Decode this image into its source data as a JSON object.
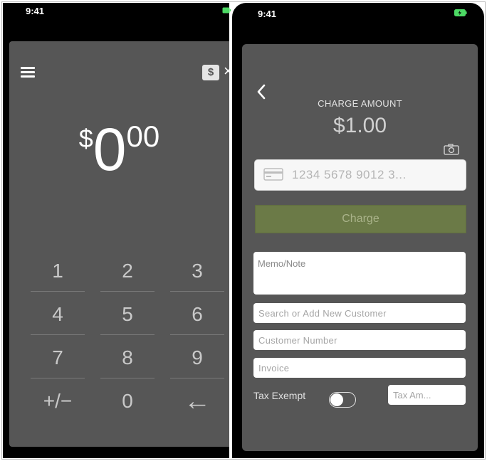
{
  "left_screen": {
    "status": {
      "time": "9:41"
    },
    "currency_icon": "$",
    "amount": {
      "currency": "$",
      "whole": "0",
      "cents": "00"
    },
    "keypad": {
      "keys": [
        {
          "label": "1"
        },
        {
          "label": "2"
        },
        {
          "label": "3"
        },
        {
          "label": "4"
        },
        {
          "label": "5"
        },
        {
          "label": "6"
        },
        {
          "label": "7"
        },
        {
          "label": "8"
        },
        {
          "label": "9"
        },
        {
          "label": "+/−"
        },
        {
          "label": "0"
        },
        {
          "label": "←"
        }
      ]
    }
  },
  "right_screen": {
    "status": {
      "time": "9:41"
    },
    "charge_label": "CHARGE AMOUNT",
    "charge_amount": "$1.00",
    "card_placeholder": "1234 5678 9012 3...",
    "charge_button": "Charge",
    "memo_placeholder": "Memo/Note",
    "customer_placeholder": "Search or Add New Customer",
    "customer_number_placeholder": "Customer Number",
    "invoice_placeholder": "Invoice",
    "tax_exempt_label": "Tax Exempt",
    "tax_exempt_on": false,
    "tax_amount_placeholder": "Tax Am..."
  },
  "colors": {
    "screen_bg": "#565656",
    "charge_button_bg": "#6b7a47",
    "battery_green": "#4cd964"
  }
}
